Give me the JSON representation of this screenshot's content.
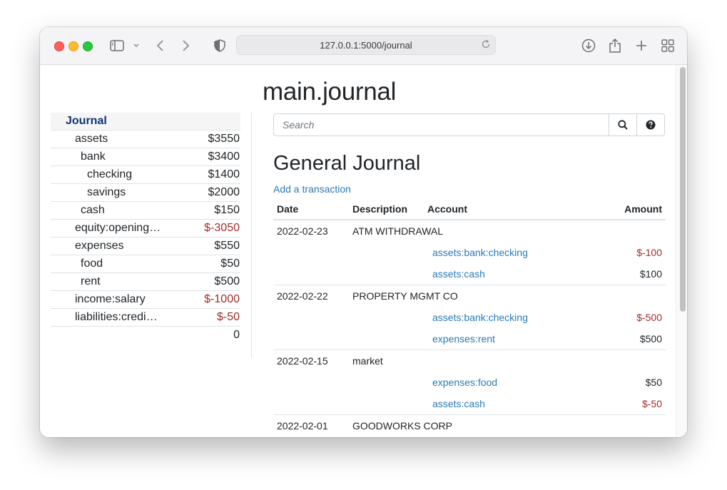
{
  "browser": {
    "url": "127.0.0.1:5000/journal"
  },
  "page": {
    "title": "main.journal"
  },
  "sidebar": {
    "header": "Journal",
    "accounts": [
      {
        "name": "assets",
        "amount": "$3550",
        "indent": 1,
        "negative": false
      },
      {
        "name": "bank",
        "amount": "$3400",
        "indent": 2,
        "negative": false
      },
      {
        "name": "checking",
        "amount": "$1400",
        "indent": 3,
        "negative": false
      },
      {
        "name": "savings",
        "amount": "$2000",
        "indent": 3,
        "negative": false
      },
      {
        "name": "cash",
        "amount": "$150",
        "indent": 2,
        "negative": false
      },
      {
        "name": "equity:opening…",
        "amount": "$-3050",
        "indent": 1,
        "negative": true
      },
      {
        "name": "expenses",
        "amount": "$550",
        "indent": 1,
        "negative": false
      },
      {
        "name": "food",
        "amount": "$50",
        "indent": 2,
        "negative": false
      },
      {
        "name": "rent",
        "amount": "$500",
        "indent": 2,
        "negative": false
      },
      {
        "name": "income:salary",
        "amount": "$-1000",
        "indent": 1,
        "negative": true
      },
      {
        "name": "liabilities:credi…",
        "amount": "$-50",
        "indent": 1,
        "negative": true
      }
    ],
    "total": "0"
  },
  "search": {
    "placeholder": "Search",
    "value": ""
  },
  "journal": {
    "heading": "General Journal",
    "add_link": "Add a transaction",
    "columns": {
      "date": "Date",
      "description": "Description",
      "account": "Account",
      "amount": "Amount"
    },
    "transactions": [
      {
        "date": "2022-02-23",
        "description": "ATM WITHDRAWAL",
        "postings": [
          {
            "account": "assets:bank:checking",
            "amount": "$-100",
            "negative": true
          },
          {
            "account": "assets:cash",
            "amount": "$100",
            "negative": false
          }
        ]
      },
      {
        "date": "2022-02-22",
        "description": "PROPERTY MGMT CO",
        "postings": [
          {
            "account": "assets:bank:checking",
            "amount": "$-500",
            "negative": true
          },
          {
            "account": "expenses:rent",
            "amount": "$500",
            "negative": false
          }
        ]
      },
      {
        "date": "2022-02-15",
        "description": "market",
        "postings": [
          {
            "account": "expenses:food",
            "amount": "$50",
            "negative": false
          },
          {
            "account": "assets:cash",
            "amount": "$-50",
            "negative": true
          }
        ]
      },
      {
        "date": "2022-02-01",
        "description": "GOODWORKS CORP",
        "postings": []
      }
    ]
  },
  "colors": {
    "link": "#2a7ab8",
    "negative": "#a02c2c",
    "sidebar_header": "#0e3471"
  }
}
